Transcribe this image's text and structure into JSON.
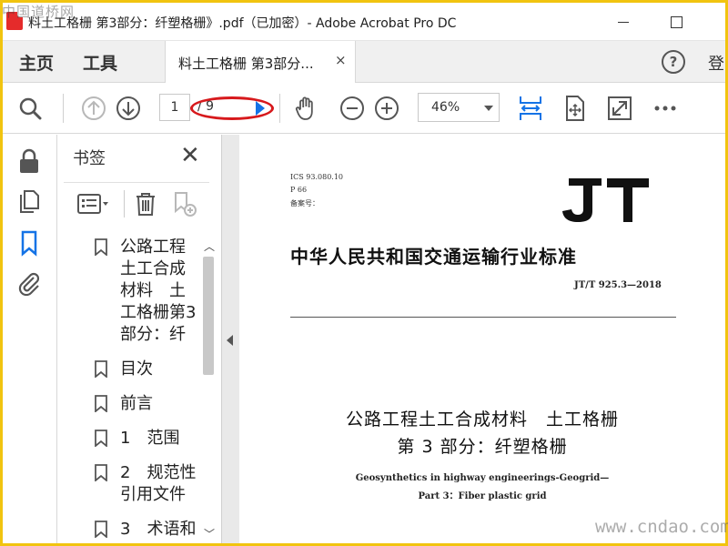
{
  "watermarks": {
    "top": "中国道桥网",
    "bottom": "www.cndao.com"
  },
  "window": {
    "title": "料土工格栅 第3部分：纤塑格栅》.pdf（已加密）- Adobe Acrobat Pro DC"
  },
  "menubar": {
    "home": "主页",
    "tools": "工具",
    "doc_tab": "料土工格栅 第3部分...",
    "close": "×",
    "help": "?",
    "login": "登"
  },
  "toolbar": {
    "current_page": "1",
    "page_total": "/ 9",
    "zoom": "46%",
    "icons": [
      "search-icon",
      "page-up-icon",
      "page-down-icon",
      "next-page-icon",
      "hand-icon",
      "zoom-out-icon",
      "zoom-in-icon",
      "fit-width-icon",
      "fit-page-icon",
      "fullscreen-icon",
      "more-icon"
    ]
  },
  "rail": {
    "icons": [
      "lock-icon",
      "pages-icon",
      "bookmark-icon",
      "attachment-icon"
    ]
  },
  "bookmarks": {
    "title": "书签",
    "close": "✕",
    "items": [
      {
        "label": "公路工程土工合成材料　土工格栅第3部分：纤"
      },
      {
        "label": "目次"
      },
      {
        "label": "前言"
      },
      {
        "label": "1　范围"
      },
      {
        "label": "2　规范性引用文件"
      },
      {
        "label": "3　术语和"
      }
    ]
  },
  "document": {
    "ics": "ICS 93.080.10",
    "p": "P 66",
    "record": "备案号：",
    "logo": "JT",
    "standard_title": "中华人民共和国交通运输行业标准",
    "code": "JT/T 925.3—2018",
    "cn_title_1": "公路工程土工合成材料　土工格栅",
    "cn_title_2": "第 3 部分：纤塑格栅",
    "en_title_1": "Geosynthetics in highway engineerings-Geogrid—",
    "en_title_2": "Part 3：Fiber plastic grid"
  },
  "colors": {
    "accent": "#1473e6",
    "annotation": "#d7191c",
    "frame": "#f1c40f",
    "pdf_red": "#e52b2b"
  }
}
